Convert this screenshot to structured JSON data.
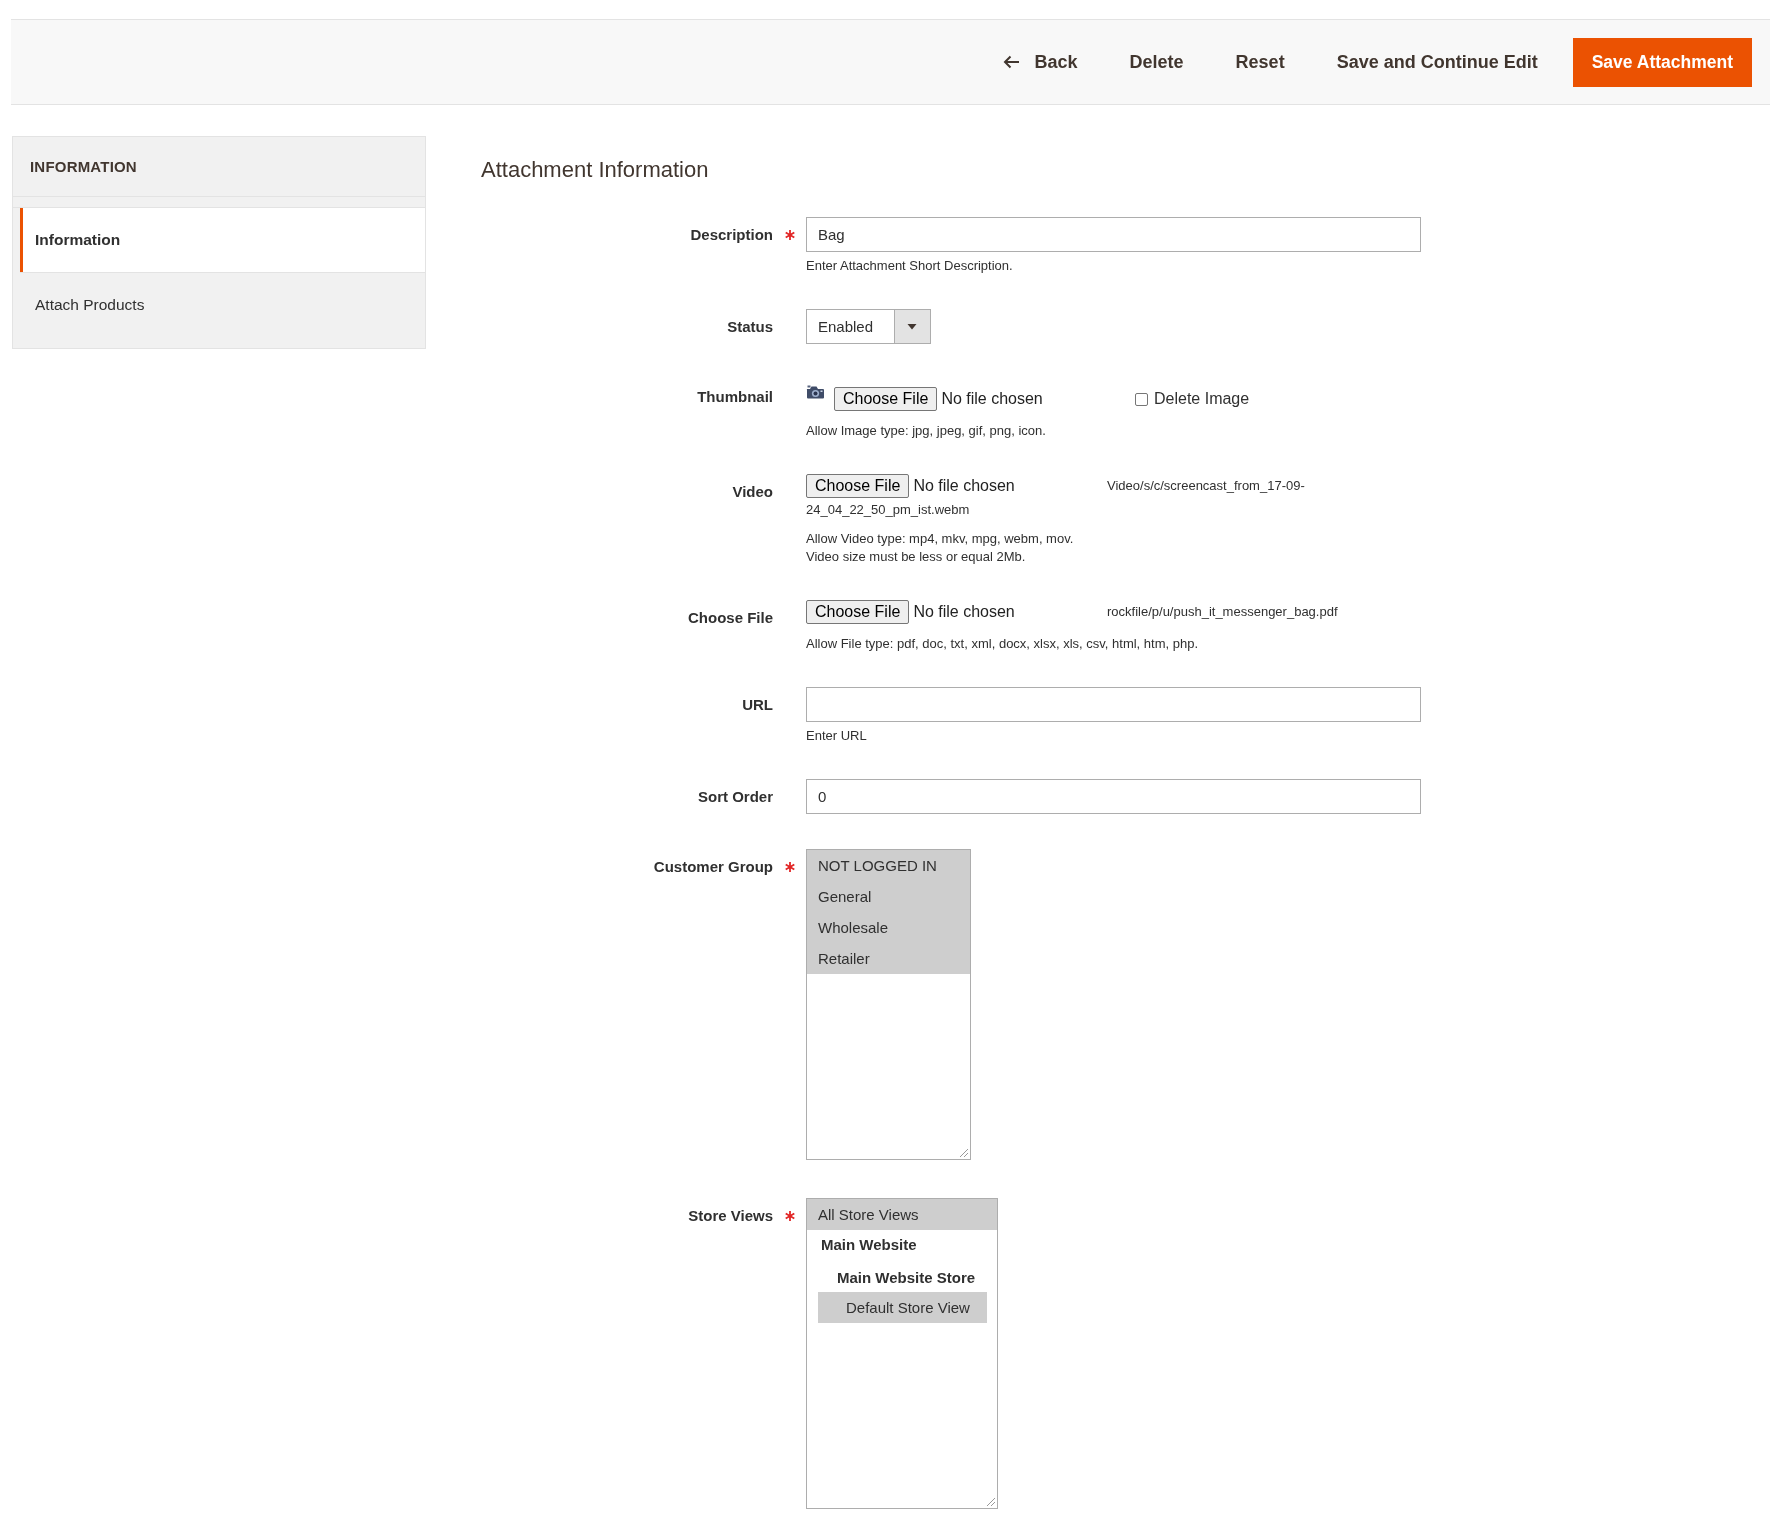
{
  "page_actions": [
    {
      "kind": "back",
      "label": "Back"
    },
    {
      "kind": "text",
      "label": "Delete"
    },
    {
      "kind": "text",
      "label": "Reset"
    },
    {
      "kind": "text",
      "label": "Save and Continue Edit"
    },
    {
      "kind": "primary",
      "label": "Save Attachment"
    }
  ],
  "sidebar": {
    "title": "INFORMATION",
    "items": [
      {
        "label": "Information",
        "selected": true
      },
      {
        "label": "Attach Products",
        "selected": false
      }
    ]
  },
  "section_title": "Attachment Information",
  "fields": [
    {
      "kind": "text",
      "label": "Description",
      "required": true,
      "value": "Bag",
      "note": [
        "Enter Attachment Short Description."
      ]
    },
    {
      "kind": "select",
      "label": "Status",
      "required": false,
      "value": "Enabled"
    },
    {
      "kind": "image",
      "label": "Thumbnail",
      "required": false,
      "button": "Choose File",
      "file_status": "No file chosen",
      "delete_checkbox": {
        "label": "Delete Image",
        "checked": false
      },
      "note": [
        "Allow Image type: jpg, jpeg, gif, png, icon."
      ]
    },
    {
      "kind": "file",
      "label": "Video",
      "required": false,
      "button": "Choose File",
      "file_status": "No file chosen",
      "current_file": [
        "Video/s/c/screencast_from_17-09-",
        "24_04_22_50_pm_ist.webm"
      ],
      "note": [
        "Allow Video type: mp4, mkv, mpg, webm, mov.",
        "Video size must be less or equal 2Mb."
      ]
    },
    {
      "kind": "file",
      "label": "Choose File",
      "required": false,
      "button": "Choose File",
      "file_status": "No file chosen",
      "current_file": [
        "rockfile/p/u/push_it_messenger_bag.pdf"
      ],
      "note": [
        "Allow File type: pdf, doc, txt, xml, docx, xlsx, xls, csv, html, htm, php."
      ]
    },
    {
      "kind": "text",
      "label": "URL",
      "required": false,
      "note": [
        "Enter URL"
      ]
    },
    {
      "kind": "text",
      "label": "Sort Order",
      "required": false,
      "value": "0"
    },
    {
      "kind": "multiselect",
      "label": "Customer Group",
      "required": true,
      "options": [
        {
          "kind": "option",
          "label": "NOT LOGGED IN",
          "selected": true
        },
        {
          "kind": "option",
          "label": "General",
          "selected": true
        },
        {
          "kind": "option",
          "label": "Wholesale",
          "selected": true
        },
        {
          "kind": "option",
          "label": "Retailer",
          "selected": true
        }
      ]
    },
    {
      "kind": "multiselect",
      "label": "Store Views",
      "required": true,
      "options": [
        {
          "kind": "option",
          "label": "All Store Views",
          "selected": true
        },
        {
          "kind": "group",
          "label": "Main Website",
          "children": [
            {
              "kind": "group",
              "label": "Main Website Store",
              "children": [
                {
                  "kind": "option",
                  "label": "Default Store View",
                  "selected": true
                }
              ]
            }
          ]
        }
      ]
    }
  ]
}
